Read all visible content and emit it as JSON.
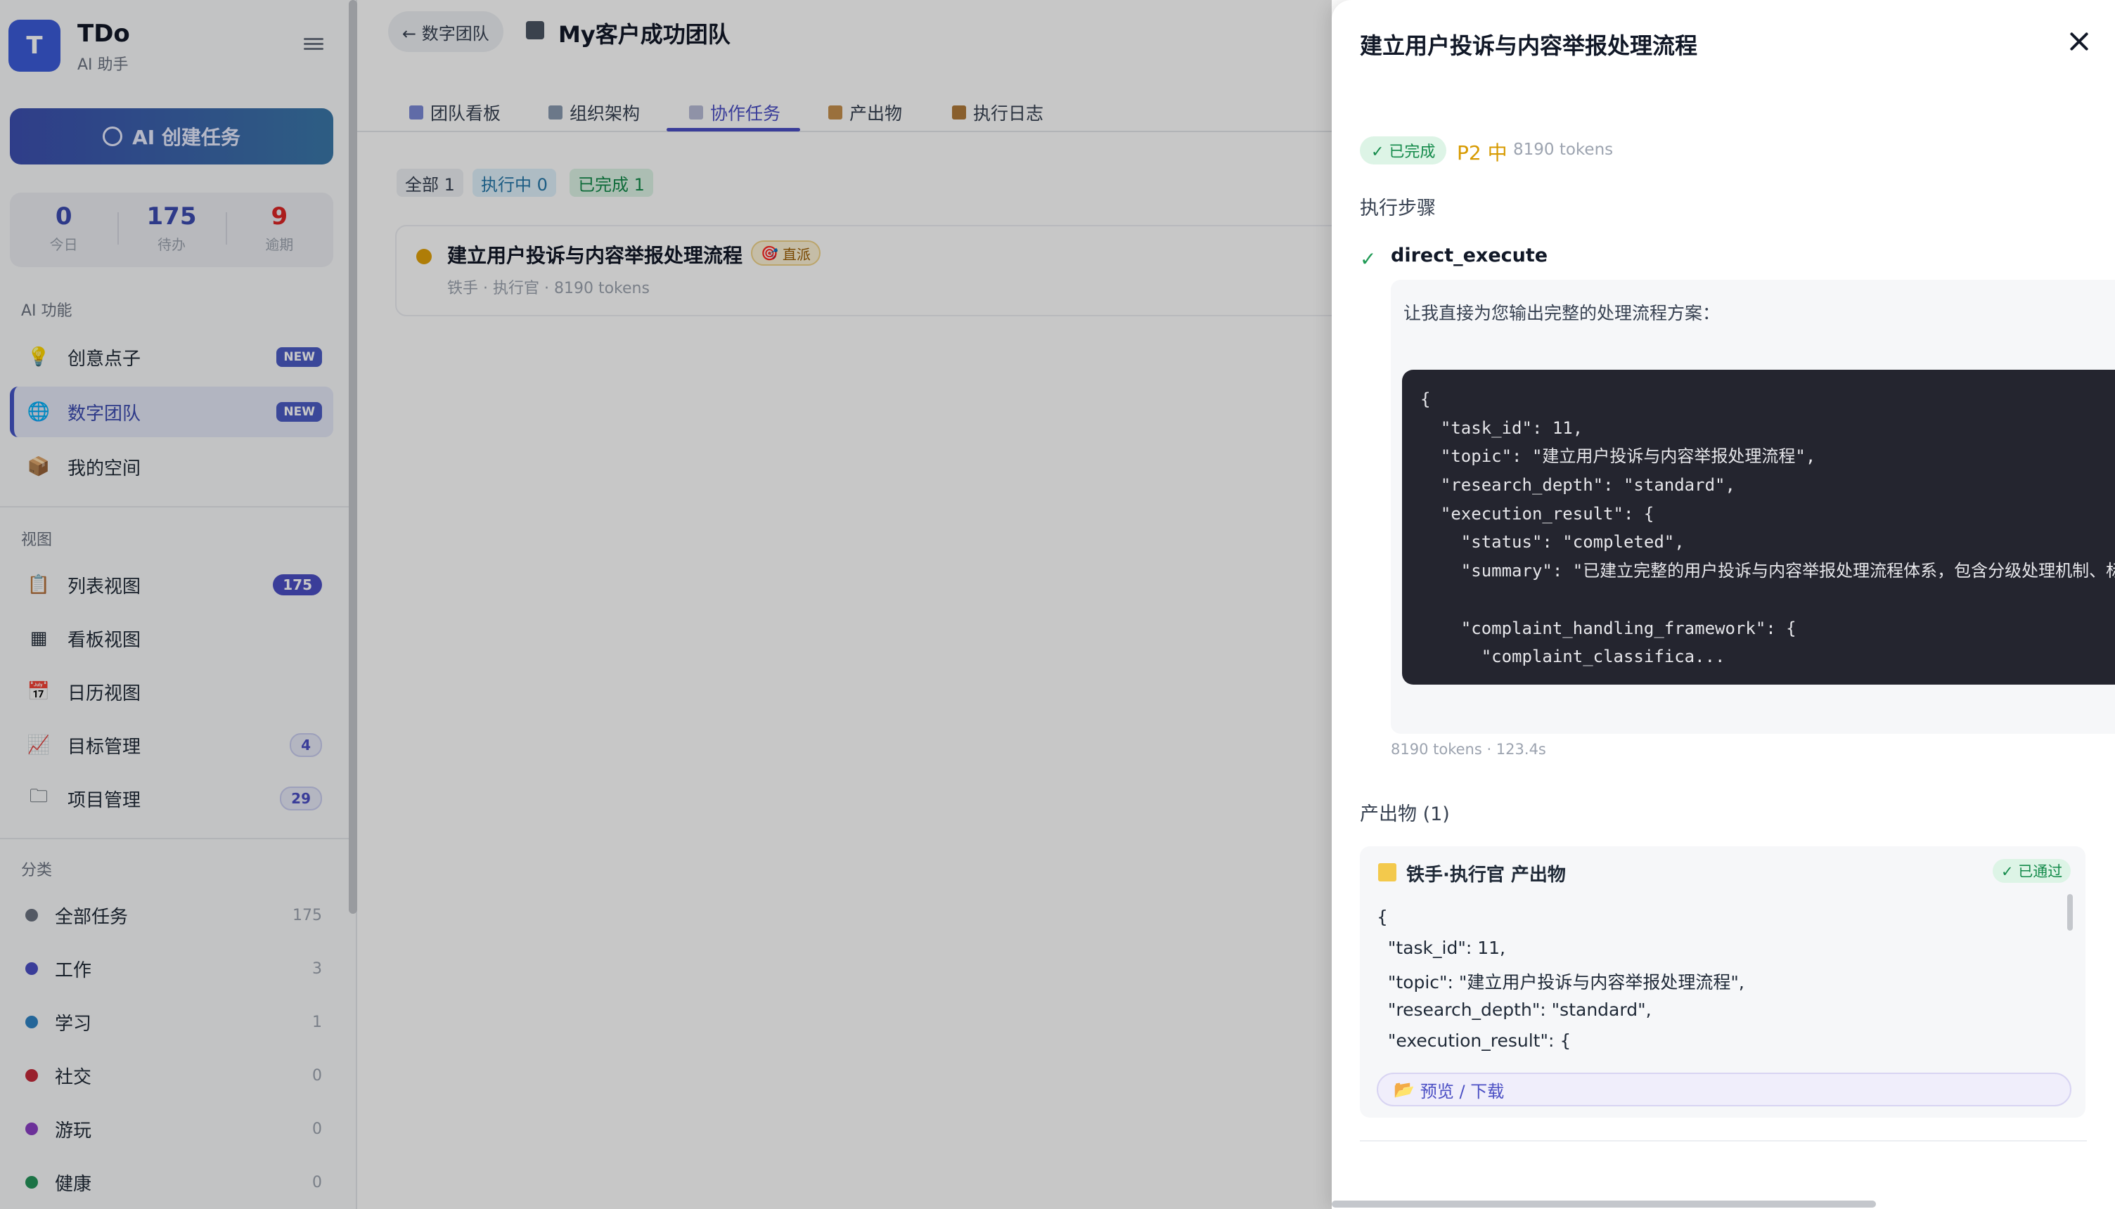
{
  "sidebar": {
    "app_initial": "T",
    "app_name": "TDo",
    "app_subtitle": "AI 助手",
    "create_button": "AI 创建任务",
    "stats": [
      {
        "value": "0",
        "label": "今日",
        "color": "#3b4bb0"
      },
      {
        "value": "175",
        "label": "待办",
        "color": "#3b4bb0"
      },
      {
        "value": "9",
        "label": "逾期",
        "color": "#dc2626"
      }
    ],
    "ai_section_label": "AI 功能",
    "ai_items": [
      {
        "label": "创意点子",
        "badge": "NEW",
        "icon": "lightbulb-icon"
      },
      {
        "label": "数字团队",
        "badge": "NEW",
        "icon": "globe-icon",
        "active": true
      },
      {
        "label": "我的空间",
        "badge": "",
        "icon": "box-icon"
      }
    ],
    "view_section_label": "视图",
    "view_items": [
      {
        "label": "列表视图",
        "badge": "175",
        "icon": "clipboard-icon"
      },
      {
        "label": "看板视图",
        "badge": "",
        "icon": "grid-icon"
      },
      {
        "label": "日历视图",
        "badge": "",
        "icon": "calendar-icon"
      },
      {
        "label": "目标管理",
        "badge": "4",
        "icon": "chart-icon"
      },
      {
        "label": "项目管理",
        "badge": "29",
        "icon": "folder-icon"
      }
    ],
    "category_section_label": "分类",
    "categories": [
      {
        "label": "全部任务",
        "count": "175",
        "color": "#6b7280"
      },
      {
        "label": "工作",
        "count": "3",
        "color": "#4b4fc4"
      },
      {
        "label": "学习",
        "count": "1",
        "color": "#2f83c4"
      },
      {
        "label": "社交",
        "count": "0",
        "color": "#c42a3a"
      },
      {
        "label": "游玩",
        "count": "0",
        "color": "#8b3fc4"
      },
      {
        "label": "健康",
        "count": "0",
        "color": "#24945a"
      }
    ]
  },
  "header": {
    "back_label": "← 数字团队",
    "team_title": "My客户成功团队"
  },
  "tabs": [
    {
      "label": "团队看板",
      "icon": "bar-chart-icon"
    },
    {
      "label": "组织架构",
      "icon": "ruler-icon"
    },
    {
      "label": "协作任务",
      "icon": "clipboard-icon",
      "active": true
    },
    {
      "label": "产出物",
      "icon": "package-icon"
    },
    {
      "label": "执行日志",
      "icon": "scroll-icon"
    }
  ],
  "filters": [
    {
      "label": "全部 1"
    },
    {
      "label": "执行中 0"
    },
    {
      "label": "已完成 1"
    }
  ],
  "task": {
    "title": "建立用户投诉与内容举报处理流程",
    "tag": "直派",
    "meta": "铁手 · 执行官 · 8190 tokens"
  },
  "drawer": {
    "title": "建立用户投诉与内容举报处理流程",
    "status": "✓ 已完成",
    "priority": "P2 中",
    "tokens": "8190 tokens",
    "steps_heading": "执行步骤",
    "step_name": "direct_execute",
    "step_intro": "让我直接为您输出完整的处理流程方案：",
    "code_lines": [
      "{",
      "  \"task_id\": 11,",
      "  \"topic\": \"建立用户投诉与内容举报处理流程\",",
      "  \"research_depth\": \"standard\",",
      "  \"execution_result\": {",
      "    \"status\": \"completed\",",
      "    \"summary\": \"已建立完整的用户投诉与内容举报处理流程体系，包含分级处理机制、标",
      "",
      "    \"complaint_handling_framework\": {",
      "      \"complaint_classifica..."
    ],
    "step_footer": "8190 tokens · 123.4s",
    "output_heading": "产出物 (1)",
    "output": {
      "title": "铁手·执行官 产出物",
      "approved": "✓ 已通过",
      "lines": [
        "{",
        "  \"task_id\": 11,",
        "  \"topic\": \"建立用户投诉与内容举报处理流程\",",
        "  \"research_depth\": \"standard\",",
        "  \"execution_result\": {"
      ],
      "preview_button": "预览 / 下载"
    }
  }
}
